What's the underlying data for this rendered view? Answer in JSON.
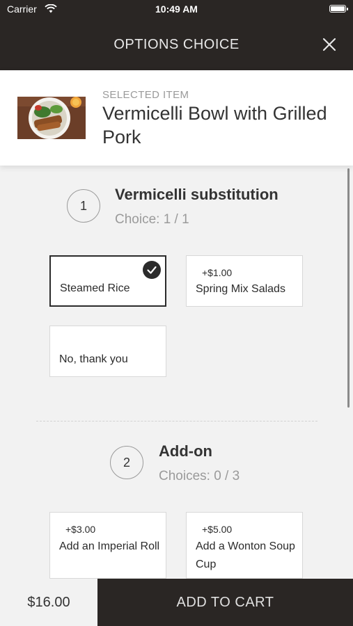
{
  "status_bar": {
    "carrier": "Carrier",
    "time": "10:49 AM"
  },
  "header": {
    "title": "OPTIONS CHOICE",
    "close_icon": "close-icon"
  },
  "selected_item": {
    "label": "SELECTED ITEM",
    "name": "Vermicelli Bowl with Grilled Pork",
    "thumbnail": "food-thumbnail"
  },
  "groups": [
    {
      "number": "1",
      "title": "Vermicelli substitution",
      "subtitle": "Choice: 1 / 1",
      "options": [
        {
          "price": "",
          "name": "Steamed Rice",
          "selected": true
        },
        {
          "price": "+$1.00",
          "name": "Spring Mix Salads",
          "selected": false
        },
        {
          "price": "",
          "name": "No, thank you",
          "selected": false
        }
      ]
    },
    {
      "number": "2",
      "title": "Add-on",
      "subtitle": "Choices: 0 / 3",
      "options": [
        {
          "price": "+$3.00",
          "name": "Add an Imperial Roll",
          "selected": false
        },
        {
          "price": "+$5.00",
          "name": "Add a Wonton Soup Cup",
          "selected": false
        }
      ]
    }
  ],
  "footer": {
    "total": "$16.00",
    "add_to_cart": "ADD TO CART"
  },
  "colors": {
    "dark": "#2a2624",
    "background": "#f2f2f2",
    "muted_text": "#9a9a9a"
  }
}
